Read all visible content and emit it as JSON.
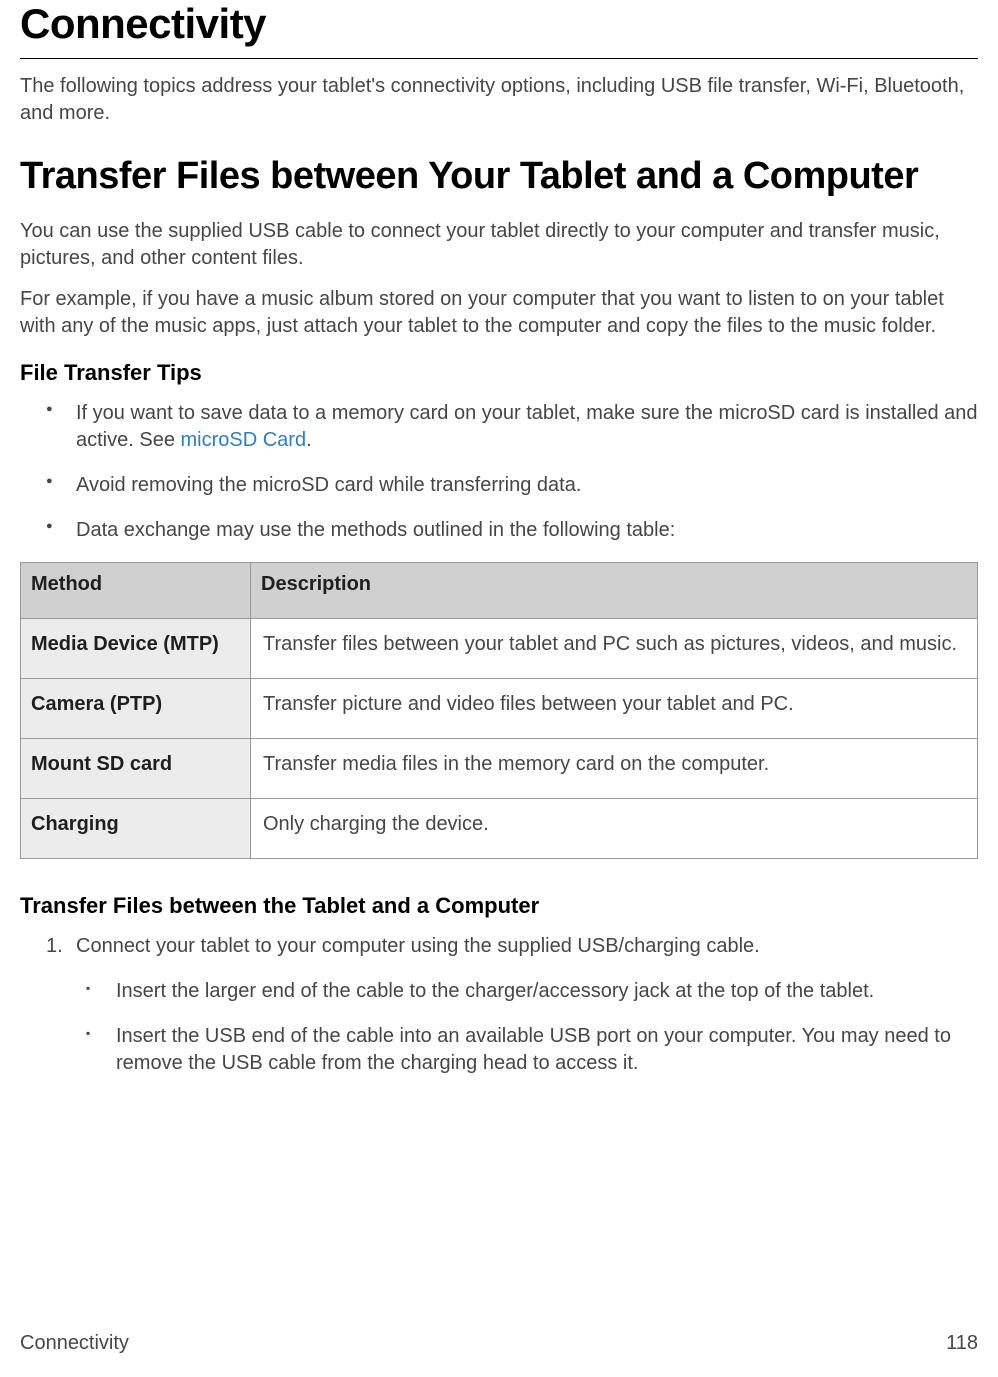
{
  "page_title": "Connectivity",
  "intro": "The following topics address your tablet's connectivity options, including USB file transfer, Wi-Fi, Bluetooth, and more.",
  "section_title": "Transfer Files between Your Tablet and a Computer",
  "body_para1": "You can use the supplied USB cable to connect your tablet directly to your computer and transfer music, pictures, and other content files.",
  "body_para2": "For example, if you have a music album stored on your computer that you want to listen to on your tablet with any of the music apps, just attach your tablet to the computer and copy the files to the music folder.",
  "tips_heading": "File Transfer Tips",
  "tips": {
    "t1_a": "If you want to save data to a memory card on your tablet, make sure the microSD card is installed and active. See ",
    "t1_link": "microSD Card",
    "t1_b": ".",
    "t2": "Avoid removing the microSD card while transferring data.",
    "t3": "Data exchange may use the methods outlined in the following table:"
  },
  "table": {
    "head_method": "Method",
    "head_desc": "Description",
    "rows": [
      {
        "method": "Media Device (MTP)",
        "desc": "Transfer files between your tablet and PC such as pictures, videos, and music."
      },
      {
        "method": "Camera (PTP)",
        "desc": "Transfer picture and video files between your tablet and PC."
      },
      {
        "method": "Mount SD card",
        "desc": "Transfer media files in the memory card on the computer."
      },
      {
        "method": "Charging",
        "desc": "Only charging the device."
      }
    ]
  },
  "procedure_heading": "Transfer Files between the Tablet and a Computer",
  "step1_lead": "Connect your tablet to your computer using the supplied USB/charging cable.",
  "step1_sub": [
    "Insert the larger end of the cable to the charger/accessory jack at the top of the tablet.",
    "Insert the USB end of the cable into an available USB port on your computer. You may need to remove the USB cable from the charging head to access it."
  ],
  "footer_left": "Connectivity",
  "footer_right": "118"
}
